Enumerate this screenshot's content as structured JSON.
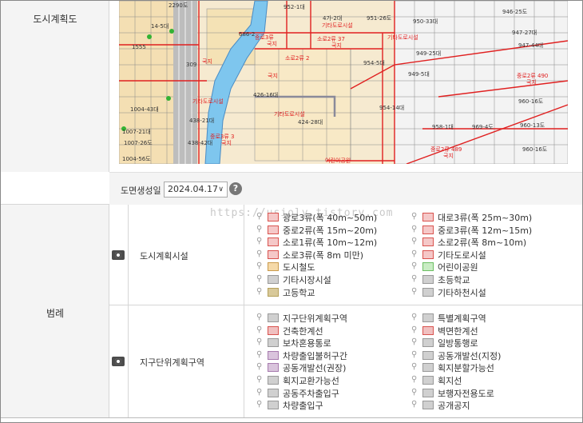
{
  "section_map_label": "도시계획도",
  "date_bar": {
    "label": "도면생성일",
    "selected_date": "2024.04.17",
    "help_icon": "question-circle-icon"
  },
  "watermark": "https://usioly.tistory.com",
  "legend_label": "범례",
  "map": {
    "labels": [
      {
        "t": "2290도"
      },
      {
        "t": "952-1대"
      },
      {
        "t": "946-25도"
      },
      {
        "t": "4가-2대"
      },
      {
        "t": "951-26도"
      },
      {
        "t": "950-33대"
      },
      {
        "t": "기타도로시설"
      },
      {
        "t": "947-27대"
      },
      {
        "t": "686-2"
      },
      {
        "t": "중로3류"
      },
      {
        "t": "소로2류 37"
      },
      {
        "t": "기타도로시설"
      },
      {
        "t": "국지"
      },
      {
        "t": "국지"
      },
      {
        "t": "947-44대"
      },
      {
        "t": "소로2류 2"
      },
      {
        "t": "954-5대"
      },
      {
        "t": "949-25대"
      },
      {
        "t": "국지"
      },
      {
        "t": "국지"
      },
      {
        "t": "중로2류 490"
      },
      {
        "t": "국지"
      },
      {
        "t": "949-5대"
      },
      {
        "t": "426-16대"
      },
      {
        "t": "기타도로시설"
      },
      {
        "t": "954-14대"
      },
      {
        "t": "960-16도"
      },
      {
        "t": "기타도로시설"
      },
      {
        "t": "438-21대"
      },
      {
        "t": "424-28대"
      },
      {
        "t": "958-1대"
      },
      {
        "t": "969-4도"
      },
      {
        "t": "960-13도"
      },
      {
        "t": "중로3류 3"
      },
      {
        "t": "국지"
      },
      {
        "t": "438-42대"
      },
      {
        "t": "960-16도"
      },
      {
        "t": "중로2류 489"
      },
      {
        "t": "국지"
      },
      {
        "t": "어린이공원"
      },
      {
        "t": "1007-21대"
      },
      {
        "t": "1007-26도"
      },
      {
        "t": "1004-56도"
      },
      {
        "t": "1004-43대"
      },
      {
        "t": "1555"
      },
      {
        "t": "14-5대"
      },
      {
        "t": "309"
      }
    ]
  },
  "legend_groups": [
    {
      "name": "도시계획시설",
      "items": [
        {
          "label": "광로3류(폭 40m~50m)",
          "color": "#f5c8c8",
          "border": "#d9534f"
        },
        {
          "label": "대로3류(폭 25m~30m)",
          "color": "#f5c8c8",
          "border": "#d9534f"
        },
        {
          "label": "중로2류(폭 15m~20m)",
          "color": "#f5c8c8",
          "border": "#d9534f"
        },
        {
          "label": "중로3류(폭 12m~15m)",
          "color": "#f5c8c8",
          "border": "#d9534f"
        },
        {
          "label": "소로1류(폭 10m~12m)",
          "color": "#f5c8c8",
          "border": "#d9534f"
        },
        {
          "label": "소로2류(폭 8m~10m)",
          "color": "#f5c8c8",
          "border": "#d9534f"
        },
        {
          "label": "소로3류(폭 8m 미만)",
          "color": "#f5c8c8",
          "border": "#d9534f"
        },
        {
          "label": "기타도로시설",
          "color": "#f5c8c8",
          "border": "#d9534f"
        },
        {
          "label": "도시철도",
          "color": "#f5d9a8",
          "border": "#c99a4d"
        },
        {
          "label": "어린이공원",
          "color": "#c9ecc4",
          "border": "#6cbf63"
        },
        {
          "label": "기타시장시설",
          "color": "#d0d0d0",
          "border": "#999"
        },
        {
          "label": "초등학교",
          "color": "#d0d0d0",
          "border": "#999"
        },
        {
          "label": "고등학교",
          "color": "#d8c99a",
          "border": "#b5a05a"
        },
        {
          "label": "기타하천시설",
          "color": "#d0d0d0",
          "border": "#999"
        }
      ]
    },
    {
      "name": "지구단위계획구역",
      "items": [
        {
          "label": "지구단위계획구역",
          "color": "#d0d0d0",
          "border": "#999"
        },
        {
          "label": "특별계획구역",
          "color": "#d0d0d0",
          "border": "#999"
        },
        {
          "label": "건축한계선",
          "color": "#f0c0c0",
          "border": "#d9534f"
        },
        {
          "label": "벽면한계선",
          "color": "#f0c0c0",
          "border": "#d9534f"
        },
        {
          "label": "보차혼용통로",
          "color": "#d0d0d0",
          "border": "#999"
        },
        {
          "label": "일방통행로",
          "color": "#d0d0d0",
          "border": "#999"
        },
        {
          "label": "차량출입불허구간",
          "color": "#d9c4dc",
          "border": "#a77bae"
        },
        {
          "label": "공동개발선(지정)",
          "color": "#d0d0d0",
          "border": "#999"
        },
        {
          "label": "공동개발선(권장)",
          "color": "#d9c4dc",
          "border": "#a77bae"
        },
        {
          "label": "획지분할가능선",
          "color": "#d0d0d0",
          "border": "#999"
        },
        {
          "label": "획지교환가능선",
          "color": "#d0d0d0",
          "border": "#999"
        },
        {
          "label": "획지선",
          "color": "#d0d0d0",
          "border": "#999"
        },
        {
          "label": "공동주차출입구",
          "color": "#d0d0d0",
          "border": "#999"
        },
        {
          "label": "보행자전용도로",
          "color": "#d0d0d0",
          "border": "#999"
        },
        {
          "label": "차량출입구",
          "color": "#d0d0d0",
          "border": "#999"
        },
        {
          "label": "공개공지",
          "color": "#d0d0d0",
          "border": "#999"
        }
      ]
    }
  ]
}
